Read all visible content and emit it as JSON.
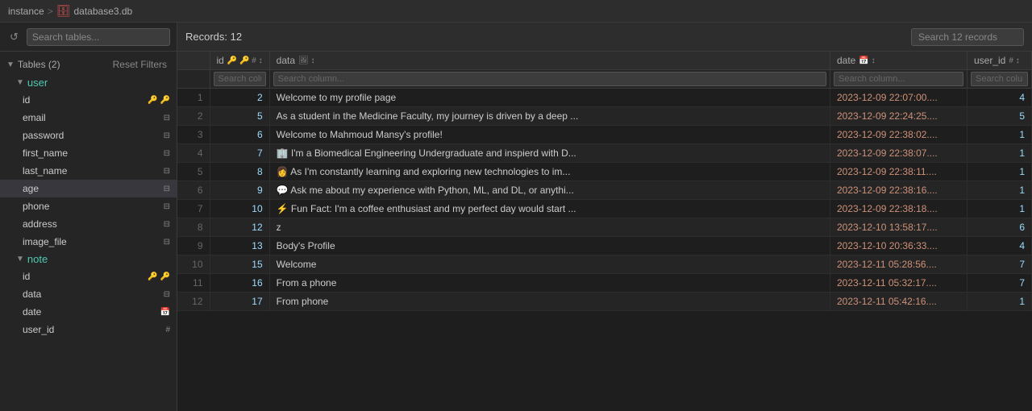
{
  "titlebar": {
    "breadcrumb": "instance",
    "separator": ">",
    "db_name": "database3.db",
    "db_icon": "🗄"
  },
  "sidebar": {
    "search_placeholder": "Search tables...",
    "reset_filters": "Reset Filters",
    "tables_label": "Tables (2)",
    "tables": [
      {
        "name": "user",
        "expanded": true,
        "fields": [
          {
            "name": "id",
            "icons": [
              "key",
              "fk"
            ]
          },
          {
            "name": "email",
            "icons": [
              "text"
            ]
          },
          {
            "name": "password",
            "icons": [
              "text"
            ]
          },
          {
            "name": "first_name",
            "icons": [
              "text"
            ]
          },
          {
            "name": "last_name",
            "icons": [
              "text"
            ]
          },
          {
            "name": "age",
            "icons": [
              "text"
            ],
            "highlighted": true
          },
          {
            "name": "phone",
            "icons": [
              "text"
            ]
          },
          {
            "name": "address",
            "icons": [
              "text"
            ]
          },
          {
            "name": "image_file",
            "icons": [
              "text"
            ]
          }
        ]
      },
      {
        "name": "note",
        "expanded": true,
        "fields": [
          {
            "name": "id",
            "icons": [
              "key",
              "fk"
            ]
          },
          {
            "name": "data",
            "icons": [
              "text"
            ]
          },
          {
            "name": "date",
            "icons": [
              "date"
            ]
          },
          {
            "name": "user_id",
            "icons": [
              "num"
            ]
          }
        ]
      }
    ]
  },
  "toolbar": {
    "records_label": "Records: 12",
    "search_placeholder": "Search 12 records"
  },
  "columns": [
    {
      "name": "id",
      "icons": "🔑 🔑 # ↕"
    },
    {
      "name": "data",
      "icons": "🖼 ↕"
    },
    {
      "name": "date",
      "icons": "📅 ↕"
    },
    {
      "name": "user_id",
      "icons": "# ↕"
    }
  ],
  "search_placeholders": {
    "id": "Search column...",
    "data": "Search column...",
    "date": "Search column...",
    "user_id": "Search column..."
  },
  "rows": [
    {
      "row": 1,
      "id": 2,
      "data": "Welcome to my profile page",
      "date": "2023-12-09 22:07:00....",
      "user_id": 4
    },
    {
      "row": 2,
      "id": 5,
      "data": "As a student in the Medicine Faculty, my journey is driven by a deep ...",
      "date": "2023-12-09 22:24:25....",
      "user_id": 5
    },
    {
      "row": 3,
      "id": 6,
      "data": "Welcome to Mahmoud Mansy's profile!",
      "date": "2023-12-09 22:38:02....",
      "user_id": 1
    },
    {
      "row": 4,
      "id": 7,
      "data": "🏢 I'm a Biomedical Engineering Undergraduate and inspierd with D...",
      "date": "2023-12-09 22:38:07....",
      "user_id": 1
    },
    {
      "row": 5,
      "id": 8,
      "data": "👩 As I'm constantly learning and exploring new technologies to im...",
      "date": "2023-12-09 22:38:11....",
      "user_id": 1
    },
    {
      "row": 6,
      "id": 9,
      "data": "💬 Ask me about my experience with Python, ML, and DL, or anythi...",
      "date": "2023-12-09 22:38:16....",
      "user_id": 1
    },
    {
      "row": 7,
      "id": 10,
      "data": "⚡ Fun Fact: I'm a coffee enthusiast and my perfect day would start ...",
      "date": "2023-12-09 22:38:18....",
      "user_id": 1
    },
    {
      "row": 8,
      "id": 12,
      "data": "z",
      "date": "2023-12-10 13:58:17....",
      "user_id": 6
    },
    {
      "row": 9,
      "id": 13,
      "data": "Body's Profile",
      "date": "2023-12-10 20:36:33....",
      "user_id": 4
    },
    {
      "row": 10,
      "id": 15,
      "data": "Welcome",
      "date": "2023-12-11 05:28:56....",
      "user_id": 7
    },
    {
      "row": 11,
      "id": 16,
      "data": "From a phone",
      "date": "2023-12-11 05:32:17....",
      "user_id": 7
    },
    {
      "row": 12,
      "id": 17,
      "data": "From phone",
      "date": "2023-12-11 05:42:16....",
      "user_id": 1
    }
  ]
}
